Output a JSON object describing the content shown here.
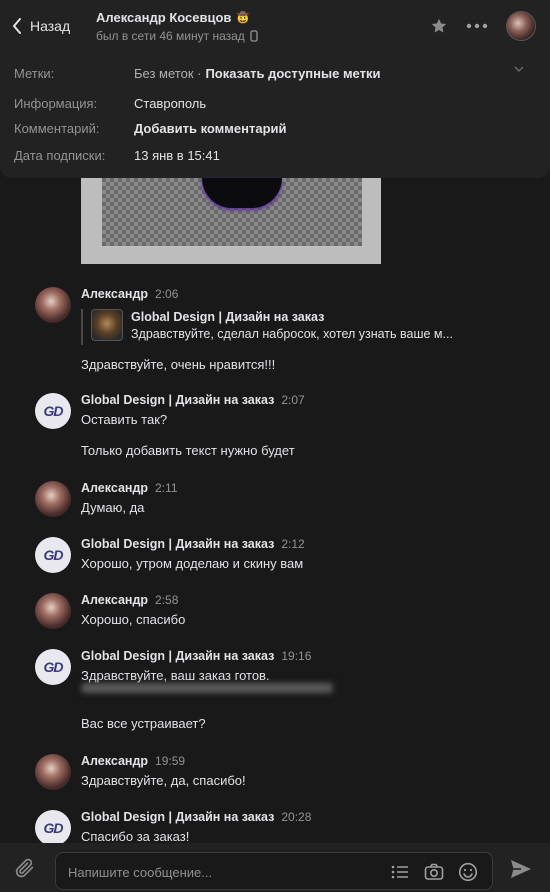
{
  "header": {
    "back_label": "Назад",
    "name": "Александр Косевцов",
    "name_emoji": "🤠",
    "status": "был в сети 46 минут назад"
  },
  "info": {
    "tags_label": "Метки:",
    "tags_value": "Без меток ·",
    "tags_link": "Показать доступные метки",
    "info_label": "Информация:",
    "info_value": "Ставрополь",
    "comment_label": "Комментарий:",
    "comment_value": "Добавить комментарий",
    "date_label": "Дата подписки:",
    "date_value": "13 янв в 15:41"
  },
  "messages": [
    {
      "name": "Александр",
      "time": "2:06",
      "reply_name": "Global Design | Дизайн на заказ",
      "reply_text": "Здравствуйте, сделал набросок, хотел узнать ваше м...",
      "text": "Здравствуйте, очень нравится!!!"
    },
    {
      "name": "Global Design | Дизайн на заказ",
      "time": "2:07",
      "text": "Оставить так?",
      "text2": "Только добавить текст нужно будет"
    },
    {
      "name": "Александр",
      "time": "2:11",
      "text": "Думаю, да"
    },
    {
      "name": "Global Design | Дизайн на заказ",
      "time": "2:12",
      "text": "Хорошо, утром доделаю и скину вам"
    },
    {
      "name": "Александр",
      "time": "2:58",
      "text": "Хорошо, спасибо"
    },
    {
      "name": "Global Design | Дизайн на заказ",
      "time": "19:16",
      "text": "Здравствуйте, ваш заказ готов.",
      "text2": "Вас все устраивает?"
    },
    {
      "name": "Александр",
      "time": "19:59",
      "text": "Здравствуйте, да, спасибо!"
    },
    {
      "name": "Global Design | Дизайн на заказ",
      "time": "20:28",
      "text": "Спасибо за заказ!"
    }
  ],
  "composer": {
    "placeholder": "Напишите сообщение..."
  },
  "icons": [
    "chevron-left-icon",
    "mobile-icon",
    "star-icon",
    "more-icon",
    "chevron-down-icon",
    "paperclip-icon",
    "list-icon",
    "camera-icon",
    "smile-icon",
    "send-icon"
  ],
  "colors": {
    "background": "#19191a",
    "panel": "#222222",
    "text": "#e1e3e6",
    "muted": "#939393"
  }
}
